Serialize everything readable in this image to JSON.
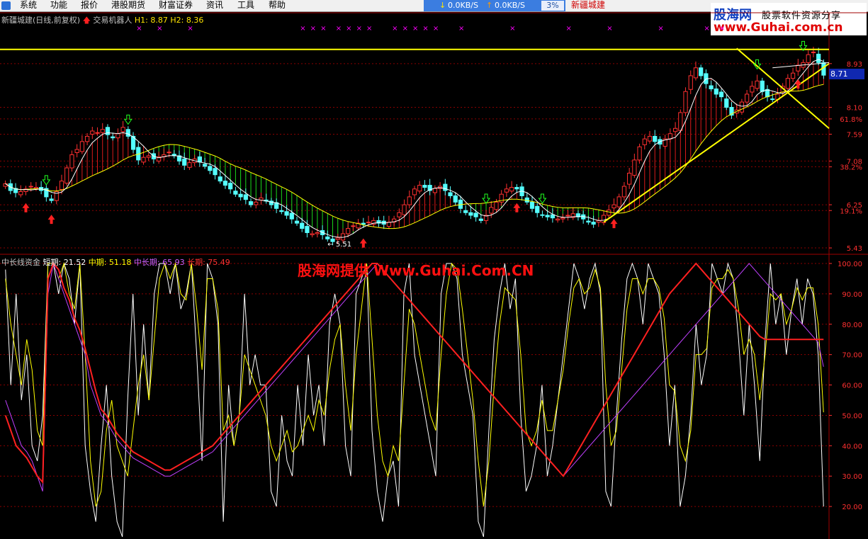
{
  "menu": {
    "items": [
      "系统",
      "功能",
      "报价",
      "港股期货",
      "财富证券",
      "资讯",
      "工具",
      "帮助"
    ]
  },
  "network": {
    "down_label": "0.0KB/S",
    "up_label": "0.0KB/S",
    "percent": "3%"
  },
  "stock_name_top": "新疆城建",
  "logo": {
    "line1a": "股海网",
    "line1b": "股票软件资源分享",
    "line2": "www.Guhai.com.cn"
  },
  "price_legend": {
    "title": "新疆城建(日线,前复权)",
    "robot": "交易机器人",
    "h1": "H1: 8.87",
    "h2": "H2: 8.36"
  },
  "indicator_legend": {
    "name": "中长线资金",
    "short": "短期: 21.52",
    "mid": "中期: 51.18",
    "midlong": "中长期: 65.93",
    "long": "长期: 75.49"
  },
  "watermark": "股海网提供 Www.Guhai.Com.CN",
  "current_price": "8.71",
  "low_annotation": "← 5.51",
  "colors": {
    "up": "#ff3030",
    "down": "#54ffff",
    "ma": "#ffffff",
    "ma_long": "#ffff00",
    "fill_up": "#ff2020",
    "fill_down": "#20ff20",
    "grid": "#8b0000",
    "axis_text": "#ff3030",
    "trendline": "#ffff00",
    "magenta_marks": "#ff00ff"
  },
  "chart_data": [
    {
      "type": "candlestick",
      "y_ticks": [
        {
          "value": 8.93,
          "label": "8.93"
        },
        {
          "value": 8.1,
          "label": "8.10"
        },
        {
          "value": 7.88,
          "label": "61.8%"
        },
        {
          "value": 7.59,
          "label": "7.59"
        },
        {
          "value": 7.08,
          "label": "7.08"
        },
        {
          "value": 6.97,
          "label": "38.2%"
        },
        {
          "value": 6.25,
          "label": "6.25"
        },
        {
          "value": 6.14,
          "label": "19.1%"
        },
        {
          "value": 5.43,
          "label": "5.43"
        }
      ],
      "ylim": [
        5.35,
        9.6
      ],
      "resistance_level": 9.2,
      "closes": [
        6.65,
        6.52,
        6.48,
        6.5,
        6.55,
        6.6,
        6.58,
        6.52,
        6.4,
        6.33,
        6.5,
        6.7,
        6.95,
        7.2,
        7.3,
        7.45,
        7.55,
        7.65,
        7.62,
        7.68,
        7.58,
        7.52,
        7.6,
        7.72,
        7.55,
        7.3,
        7.1,
        7.15,
        7.18,
        7.12,
        7.16,
        7.2,
        7.25,
        7.18,
        7.08,
        7.0,
        7.05,
        7.12,
        7.06,
        6.98,
        6.9,
        6.82,
        6.7,
        6.62,
        6.55,
        6.45,
        6.4,
        6.35,
        6.25,
        6.3,
        6.38,
        6.32,
        6.25,
        6.18,
        6.12,
        6.05,
        5.98,
        5.9,
        5.8,
        5.72,
        5.7,
        5.72,
        5.68,
        5.6,
        5.55,
        5.62,
        5.7,
        5.8,
        5.85,
        5.9,
        5.88,
        5.92,
        5.95,
        5.9,
        5.88,
        5.92,
        5.98,
        6.1,
        6.25,
        6.4,
        6.55,
        6.62,
        6.58,
        6.52,
        6.56,
        6.6,
        6.52,
        6.42,
        6.3,
        6.18,
        6.1,
        6.05,
        6.02,
        5.95,
        6.05,
        6.2,
        6.3,
        6.45,
        6.55,
        6.58,
        6.55,
        6.42,
        6.3,
        6.18,
        6.1,
        6.05,
        6.02,
        6.0,
        5.98,
        6.0,
        6.05,
        6.08,
        6.02,
        5.98,
        5.92,
        5.88,
        5.95,
        6.05,
        6.15,
        6.25,
        6.4,
        6.6,
        6.85,
        7.1,
        7.35,
        7.5,
        7.55,
        7.45,
        7.4,
        7.5,
        7.6,
        7.7,
        8.0,
        8.4,
        8.7,
        8.85,
        8.7,
        8.55,
        8.45,
        8.35,
        8.3,
        8.1,
        7.95,
        8.05,
        8.2,
        8.35,
        8.5,
        8.6,
        8.4,
        8.3,
        8.25,
        8.35,
        8.5,
        8.65,
        8.75,
        8.9,
        8.95,
        9.1,
        9.15,
        8.95,
        8.71
      ]
    },
    {
      "type": "line",
      "ylim": [
        10,
        100
      ],
      "y_ticks": [
        100,
        90,
        80,
        70,
        60,
        50,
        40,
        30,
        20
      ],
      "series": [
        {
          "name": "短期",
          "values": [
            98,
            60,
            90,
            55,
            70,
            40,
            35,
            50,
            100,
            100,
            90,
            100,
            95,
            80,
            100,
            40,
            25,
            15,
            40,
            60,
            30,
            15,
            10,
            55,
            90,
            50,
            80,
            55,
            90,
            100,
            100,
            90,
            100,
            85,
            90,
            100,
            70,
            35,
            100,
            95,
            80,
            15,
            60,
            40,
            50,
            90,
            60,
            70,
            60,
            60,
            25,
            20,
            50,
            35,
            30,
            60,
            40,
            70,
            50,
            60,
            40,
            80,
            90,
            80,
            40,
            30,
            90,
            95,
            100,
            45,
            25,
            15,
            30,
            35,
            20,
            90,
            100,
            70,
            60,
            50,
            40,
            30,
            90,
            100,
            100,
            95,
            70,
            60,
            50,
            15,
            10,
            45,
            75,
            90,
            100,
            85,
            95,
            50,
            25,
            30,
            40,
            60,
            30,
            40,
            55,
            70,
            85,
            100,
            95,
            85,
            95,
            100,
            90,
            25,
            20,
            50,
            75,
            95,
            100,
            95,
            80,
            100,
            95,
            90,
            70,
            40,
            60,
            20,
            30,
            50,
            80,
            60,
            70,
            100,
            95,
            90,
            100,
            95,
            75,
            50,
            80,
            60,
            35,
            75,
            100,
            80,
            90,
            70,
            85,
            95,
            80,
            95,
            90,
            70,
            20
          ]
        },
        {
          "name": "中期",
          "values": [
            95,
            80,
            70,
            60,
            75,
            65,
            45,
            40,
            100,
            100,
            95,
            100,
            90,
            85,
            100,
            70,
            35,
            20,
            25,
            45,
            55,
            40,
            35,
            30,
            45,
            60,
            70,
            55,
            75,
            95,
            100,
            95,
            100,
            90,
            88,
            100,
            85,
            65,
            95,
            95,
            85,
            45,
            50,
            40,
            50,
            70,
            65,
            60,
            55,
            50,
            40,
            35,
            40,
            45,
            38,
            40,
            45,
            50,
            45,
            55,
            50,
            65,
            75,
            80,
            60,
            45,
            70,
            85,
            100,
            75,
            50,
            35,
            30,
            40,
            35,
            60,
            85,
            80,
            70,
            60,
            50,
            45,
            70,
            90,
            100,
            98,
            85,
            70,
            55,
            35,
            20,
            35,
            60,
            80,
            92,
            90,
            88,
            70,
            45,
            40,
            45,
            55,
            45,
            45,
            55,
            65,
            80,
            92,
            95,
            90,
            92,
            98,
            92,
            60,
            40,
            45,
            65,
            85,
            95,
            95,
            90,
            95,
            95,
            92,
            82,
            60,
            58,
            40,
            35,
            45,
            70,
            70,
            72,
            92,
            95,
            95,
            98,
            95,
            85,
            70,
            75,
            70,
            55,
            70,
            90,
            88,
            90,
            80,
            85,
            92,
            88,
            92,
            92,
            80,
            51
          ]
        },
        {
          "name": "中长期",
          "values": [
            55,
            50,
            45,
            40,
            38,
            35,
            30,
            25,
            90,
            100,
            95,
            90,
            85,
            80,
            75,
            70,
            60,
            55,
            50,
            48,
            45,
            42,
            40,
            38,
            36,
            35,
            34,
            33,
            32,
            31,
            30,
            30,
            31,
            32,
            33,
            34,
            35,
            36,
            37,
            38,
            40,
            42,
            44,
            46,
            48,
            50,
            52,
            54,
            56,
            58,
            60,
            62,
            64,
            66,
            68,
            70,
            72,
            74,
            76,
            78,
            80,
            82,
            84,
            86,
            88,
            90,
            92,
            94,
            96,
            98,
            100,
            98,
            96,
            94,
            92,
            90,
            88,
            86,
            84,
            82,
            80,
            78,
            76,
            74,
            72,
            70,
            68,
            66,
            64,
            62,
            60,
            58,
            56,
            54,
            52,
            50,
            48,
            46,
            44,
            42,
            40,
            38,
            36,
            34,
            32,
            30,
            32,
            34,
            36,
            38,
            40,
            42,
            44,
            46,
            48,
            50,
            52,
            54,
            56,
            58,
            60,
            62,
            64,
            66,
            68,
            70,
            72,
            74,
            76,
            78,
            80,
            82,
            84,
            86,
            88,
            90,
            92,
            94,
            96,
            98,
            100,
            98,
            96,
            94,
            92,
            90,
            88,
            86,
            84,
            82,
            80,
            78,
            76,
            74,
            66
          ]
        },
        {
          "name": "长期",
          "values": [
            50,
            45,
            40,
            38,
            36,
            33,
            30,
            28,
            95,
            100,
            98,
            92,
            88,
            82,
            78,
            72,
            65,
            58,
            52,
            50,
            47,
            44,
            42,
            40,
            38,
            37,
            36,
            35,
            34,
            33,
            32,
            32,
            33,
            34,
            35,
            36,
            37,
            38,
            39,
            40,
            42,
            44,
            46,
            48,
            50,
            52,
            54,
            56,
            58,
            60,
            62,
            64,
            66,
            68,
            70,
            72,
            74,
            76,
            78,
            80,
            82,
            84,
            86,
            88,
            90,
            92,
            94,
            96,
            98,
            100,
            100,
            98,
            96,
            94,
            92,
            90,
            88,
            86,
            84,
            82,
            80,
            78,
            76,
            74,
            72,
            70,
            68,
            66,
            64,
            62,
            60,
            58,
            56,
            54,
            52,
            50,
            48,
            46,
            44,
            42,
            40,
            38,
            36,
            34,
            32,
            30,
            33,
            36,
            39,
            42,
            45,
            48,
            51,
            54,
            57,
            60,
            63,
            66,
            69,
            72,
            75,
            78,
            81,
            84,
            87,
            90,
            92,
            94,
            96,
            98,
            100,
            98,
            96,
            94,
            92,
            90,
            88,
            86,
            84,
            82,
            80,
            78,
            76,
            75,
            75,
            75,
            75,
            75,
            75,
            75,
            75,
            75,
            75,
            75,
            75
          ]
        }
      ]
    }
  ]
}
